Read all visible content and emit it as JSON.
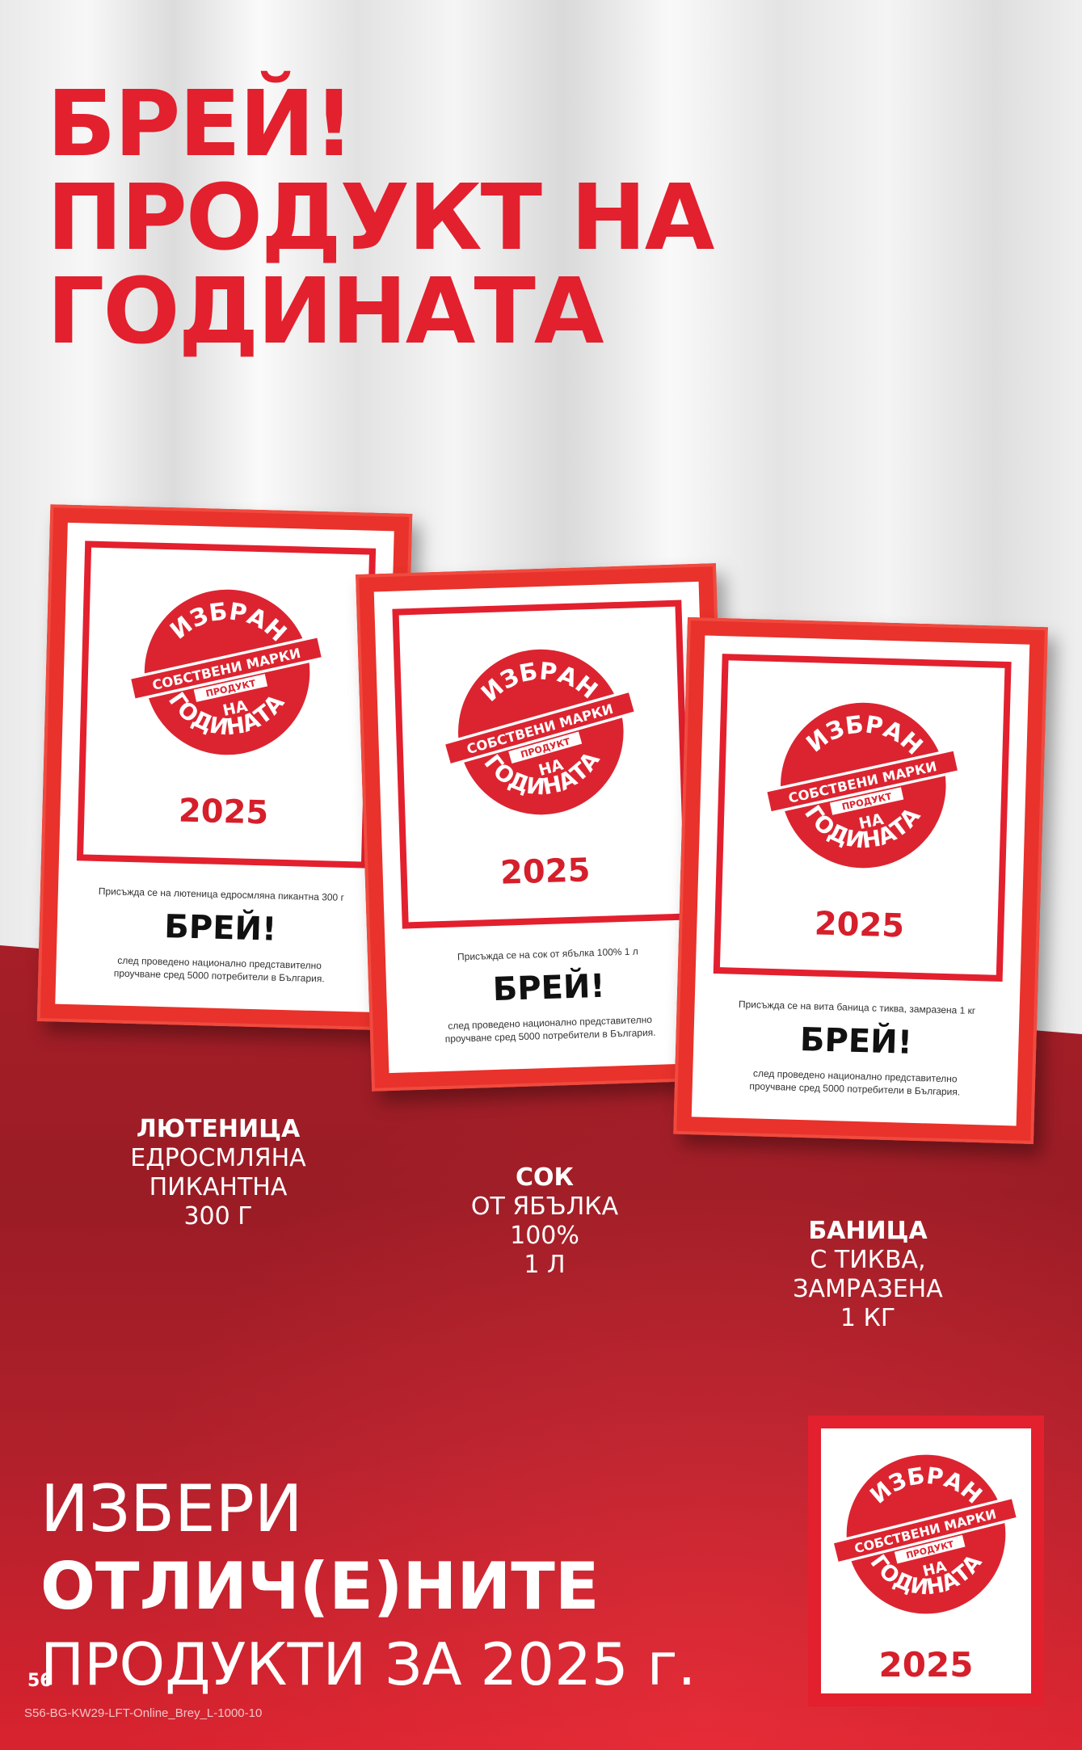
{
  "headline": {
    "line1": "БРЕЙ!",
    "line2": "ПРОДУКТ НА",
    "line3": "ГОДИНАТА"
  },
  "seal": {
    "top": "ИЗБРАН",
    "band": "СОБСТВЕНИ МАРКИ",
    "sub": "ПРОДУКТ",
    "na": "НА",
    "bottom": "ГОДИНАТА"
  },
  "frames": [
    {
      "year": "2025",
      "caption": "Присъжда се на лютеница едросмляна пикантна 300 г",
      "brand": "БРЕЙ!",
      "note_line1": "след проведено национално представително",
      "note_line2": "проучване сред 5000 потребители в България."
    },
    {
      "year": "2025",
      "caption": "Присъжда се на сок от ябълка 100% 1 л",
      "brand": "БРЕЙ!",
      "note_line1": "след проведено национално представително",
      "note_line2": "проучване сред 5000 потребители в България."
    },
    {
      "year": "2025",
      "caption": "Присъжда се на вита баница с тиква, замразена 1 кг",
      "brand": "БРЕЙ!",
      "note_line1": "след проведено национално представително",
      "note_line2": "проучване сред 5000 потребители в България."
    }
  ],
  "products": [
    {
      "name": "ЛЮТЕНИЦА",
      "line1": "ЕДРОСМЛЯНА",
      "line2": "ПИКАНТНА",
      "line3": "300 Г"
    },
    {
      "name": "СОК",
      "line1": "ОТ ЯБЪЛКА",
      "line2": "100%",
      "line3": "1 Л"
    },
    {
      "name": "БАНИЦА",
      "line1": "С ТИКВА,",
      "line2": "ЗАМРАЗЕНА",
      "line3": "1 КГ"
    }
  ],
  "bottom": {
    "line1": "ИЗБЕРИ",
    "line2": "ОТЛИЧ(Е)НИТЕ",
    "line3": "ПРОДУКТИ ЗА 2025 г."
  },
  "badge": {
    "year": "2025"
  },
  "page_number": "56",
  "footer_code": "S56-BG-KW29-LFT-Online_Brey_L-1000-10",
  "colors": {
    "brand_red": "#e3202e",
    "floor_red": "#a81f28",
    "white": "#ffffff"
  }
}
